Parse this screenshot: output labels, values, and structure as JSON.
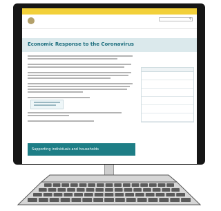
{
  "banner": {
    "text": ""
  },
  "header": {
    "department": "",
    "top_links": [
      "",
      "",
      ""
    ]
  },
  "nav": {
    "items": [
      "",
      "",
      "",
      "",
      "",
      "",
      ""
    ]
  },
  "breadcrumb": {
    "items": [
      "",
      "",
      ""
    ]
  },
  "page": {
    "title": "Economic Response to the Coronavirus"
  },
  "support": {
    "label": "Supporting individuals and households"
  },
  "sidebar": {
    "header": "",
    "items": [
      "",
      "",
      "",
      "",
      "",
      ""
    ]
  },
  "icons": {
    "search": "search-icon",
    "crest": "coat-of-arms-icon"
  },
  "colors": {
    "banner": "#f2d03a",
    "title_band": "#dbe9ec",
    "title_text": "#1c6d7d",
    "support_banner": "#1e7e86",
    "monitor_bezel": "#161616",
    "keyboard_keys": "#5a5a5a"
  }
}
